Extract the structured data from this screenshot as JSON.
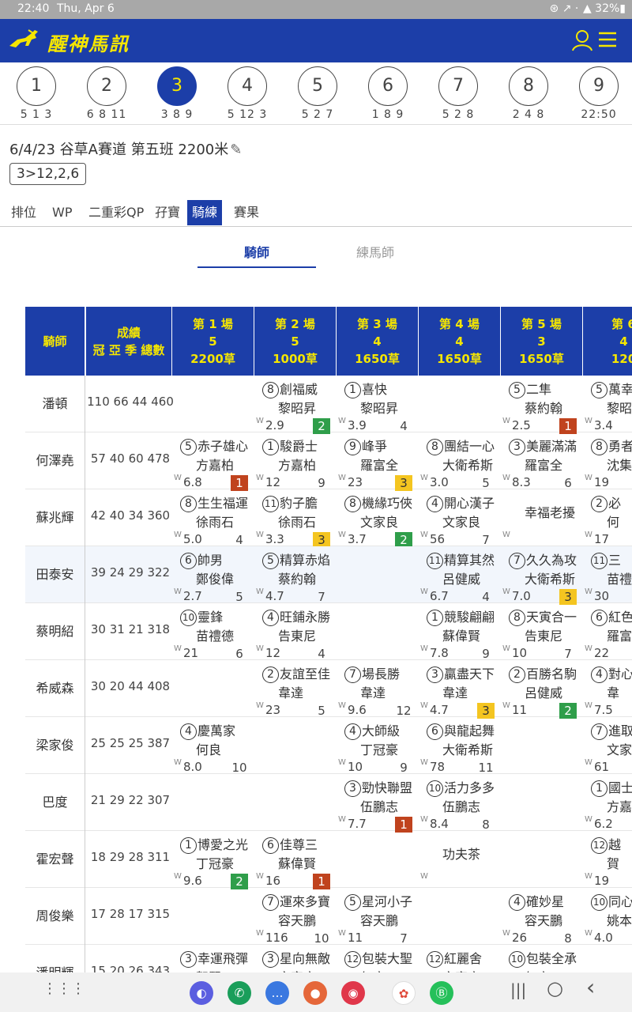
{
  "status": {
    "time": "22:40",
    "date": "Thu, Apr 6",
    "right": "⊛ ↗ ·  ▲ 32%▮"
  },
  "app": {
    "title": "醒神馬訊",
    "logo": "horse-logo",
    "accent": "#1c3ea8",
    "brand_yellow": "#f5e600"
  },
  "races": [
    {
      "num": "1",
      "sub": "5 1 3"
    },
    {
      "num": "2",
      "sub": "6 8 11"
    },
    {
      "num": "3",
      "sub": "3 8 9",
      "active": true
    },
    {
      "num": "4",
      "sub": "5 12 3"
    },
    {
      "num": "5",
      "sub": "5 2 7"
    },
    {
      "num": "6",
      "sub": "1 8 9"
    },
    {
      "num": "7",
      "sub": "5 2 8"
    },
    {
      "num": "8",
      "sub": "2 4 8"
    },
    {
      "num": "9",
      "sub": "22:50"
    }
  ],
  "race_info": "6/4/23 谷草A賽道  第五班 2200米",
  "pencil": "✎",
  "tag": "3>12,2,6",
  "tabs": [
    "排位",
    "WP",
    "二重彩QP",
    "孖寶",
    "騎練",
    "賽果"
  ],
  "active_tab": 4,
  "subtabs": [
    "騎師",
    "練馬師"
  ],
  "header": {
    "jockey": "騎師",
    "record": [
      "成績",
      "冠 亞 季 總數"
    ],
    "races": [
      [
        "第 1 場",
        "5",
        "2200草"
      ],
      [
        "第 2 場",
        "5",
        "1000草"
      ],
      [
        "第 3 場",
        "4",
        "1650草"
      ],
      [
        "第 4 場",
        "4",
        "1650草"
      ],
      [
        "第 5 場",
        "3",
        "1650草"
      ],
      [
        "第 6",
        "4",
        "120"
      ]
    ]
  },
  "w_label": "W",
  "rows": [
    {
      "jockey": "潘頓",
      "stat": "110 66 44 460",
      "cells": [
        null,
        {
          "n": "8",
          "h": "創福威",
          "j": "黎昭昇",
          "o": "2.9",
          "p": "2"
        },
        {
          "n": "1",
          "h": "喜快",
          "j": "黎昭昇",
          "o": "3.9",
          "p": "4"
        },
        null,
        {
          "n": "5",
          "h": "二隼",
          "j": "蔡約翰",
          "o": "2.5",
          "p": "1"
        },
        {
          "n": "5",
          "h": "萬幸",
          "j": "黎昭",
          "o": "3.4",
          "p": ""
        }
      ]
    },
    {
      "jockey": "何澤堯",
      "stat": "57 40 60 478",
      "cells": [
        {
          "n": "5",
          "h": "赤子雄心",
          "j": "方嘉柏",
          "o": "6.8",
          "p": "1"
        },
        {
          "n": "1",
          "h": "駿爵士",
          "j": "方嘉柏",
          "o": "12",
          "p": "9"
        },
        {
          "n": "9",
          "h": "峰爭",
          "j": "羅富全",
          "o": "23",
          "p": "3"
        },
        {
          "n": "8",
          "h": "團結一心",
          "j": "大衛希斯",
          "o": "3.0",
          "p": "5"
        },
        {
          "n": "3",
          "h": "美麗滿滿",
          "j": "羅富全",
          "o": "8.3",
          "p": "6"
        },
        {
          "n": "8",
          "h": "勇者",
          "j": "沈集",
          "o": "19",
          "p": ""
        }
      ]
    },
    {
      "jockey": "蘇兆輝",
      "stat": "42 40 34 360",
      "cells": [
        {
          "n": "8",
          "h": "生生福運",
          "j": "徐雨石",
          "o": "5.0",
          "p": "4"
        },
        {
          "n": "11",
          "h": "豹子膽",
          "j": "徐雨石",
          "o": "3.3",
          "p": "3"
        },
        {
          "n": "8",
          "h": "機緣巧俠",
          "j": "文家良",
          "o": "3.7",
          "p": "2"
        },
        {
          "n": "4",
          "h": "開心漢子",
          "j": "文家良",
          "o": "56",
          "p": "7"
        },
        {
          "n": "",
          "h": "幸福老擾",
          "j": "",
          "o": "",
          "p": ""
        },
        {
          "n": "2",
          "h": "必",
          "j": "何",
          "o": "17",
          "p": ""
        }
      ]
    },
    {
      "jockey": "田泰安",
      "stat": "39 24 29 322",
      "cells": [
        {
          "n": "6",
          "h": "帥男",
          "j": "鄭俊偉",
          "o": "2.7",
          "p": "5"
        },
        {
          "n": "5",
          "h": "精算赤焰",
          "j": "蔡約翰",
          "o": "4.7",
          "p": "7"
        },
        null,
        {
          "n": "11",
          "h": "精算其然",
          "j": "呂健威",
          "o": "6.7",
          "p": "4"
        },
        {
          "n": "7",
          "h": "久久為攻",
          "j": "大衛希斯",
          "o": "7.0",
          "p": "3"
        },
        {
          "n": "11",
          "h": "三",
          "j": "苗禮",
          "o": "30",
          "p": ""
        }
      ]
    },
    {
      "jockey": "蔡明紹",
      "stat": "30 31 21 318",
      "cells": [
        {
          "n": "10",
          "h": "靈鋒",
          "j": "苗禮德",
          "o": "21",
          "p": "6"
        },
        {
          "n": "4",
          "h": "旺鋪永勝",
          "j": "告東尼",
          "o": "12",
          "p": "4"
        },
        null,
        {
          "n": "1",
          "h": "競駿翩翩",
          "j": "蘇偉賢",
          "o": "7.8",
          "p": "9"
        },
        {
          "n": "8",
          "h": "天寅合一",
          "j": "告東尼",
          "o": "10",
          "p": "7"
        },
        {
          "n": "6",
          "h": "紅色",
          "j": "羅富",
          "o": "22",
          "p": ""
        }
      ]
    },
    {
      "jockey": "希威森",
      "stat": "30 20 44 408",
      "cells": [
        null,
        {
          "n": "2",
          "h": "友誼至佳",
          "j": "韋達",
          "o": "23",
          "p": "5"
        },
        {
          "n": "7",
          "h": "場長勝",
          "j": "韋達",
          "o": "9.6",
          "p": "12"
        },
        {
          "n": "3",
          "h": "贏盡天下",
          "j": "韋達",
          "o": "4.7",
          "p": "3"
        },
        {
          "n": "2",
          "h": "百勝名駒",
          "j": "呂健威",
          "o": "11",
          "p": "2"
        },
        {
          "n": "4",
          "h": "對心",
          "j": "韋",
          "o": "7.5",
          "p": ""
        }
      ]
    },
    {
      "jockey": "梁家俊",
      "stat": "25 25 25 387",
      "cells": [
        {
          "n": "4",
          "h": "慶萬家",
          "j": "何良",
          "o": "8.0",
          "p": "10"
        },
        null,
        {
          "n": "4",
          "h": "大師級",
          "j": "丁冠豪",
          "o": "10",
          "p": "9"
        },
        {
          "n": "6",
          "h": "與龍起舞",
          "j": "大衛希斯",
          "o": "78",
          "p": "11"
        },
        null,
        {
          "n": "7",
          "h": "進取",
          "j": "文家",
          "o": "61",
          "p": ""
        }
      ]
    },
    {
      "jockey": "巴度",
      "stat": "21 29 22 307",
      "cells": [
        null,
        null,
        {
          "n": "3",
          "h": "勁快聯盟",
          "j": "伍鵬志",
          "o": "7.7",
          "p": "1"
        },
        {
          "n": "10",
          "h": "活力多多",
          "j": "伍鵬志",
          "o": "8.4",
          "p": "8"
        },
        null,
        {
          "n": "1",
          "h": "國士",
          "j": "方嘉",
          "o": "6.2",
          "p": ""
        }
      ]
    },
    {
      "jockey": "霍宏聲",
      "stat": "18 29 28 311",
      "cells": [
        {
          "n": "1",
          "h": "博愛之光",
          "j": "丁冠豪",
          "o": "9.6",
          "p": "2"
        },
        {
          "n": "6",
          "h": "佳尊三",
          "j": "蘇偉賢",
          "o": "16",
          "p": "1"
        },
        null,
        {
          "n": "",
          "h": "功夫茶",
          "j": "",
          "o": "",
          "p": ""
        },
        null,
        {
          "n": "12",
          "h": "越",
          "j": "賀",
          "o": "19",
          "p": ""
        }
      ]
    },
    {
      "jockey": "周俊樂",
      "stat": "17 28 17 315",
      "cells": [
        null,
        {
          "n": "7",
          "h": "運來多寶",
          "j": "容天鵬",
          "o": "116",
          "p": "10"
        },
        {
          "n": "5",
          "h": "星河小子",
          "j": "容天鵬",
          "o": "11",
          "p": "7"
        },
        null,
        {
          "n": "4",
          "h": "確妙星",
          "j": "容天鵬",
          "o": "26",
          "p": "8"
        },
        {
          "n": "10",
          "h": "同心",
          "j": "姚本",
          "o": "4.0",
          "p": ""
        }
      ]
    },
    {
      "jockey": "潘明輝",
      "stat": "15 20 26 343",
      "cells": [
        {
          "n": "3",
          "h": "幸運飛彈",
          "j": "賀賢",
          "o": "",
          "p": ""
        },
        {
          "n": "3",
          "h": "星向無敵",
          "j": "文家良",
          "o": "",
          "p": ""
        },
        {
          "n": "12",
          "h": "包裝大聖",
          "j": "何良",
          "o": "",
          "p": ""
        },
        {
          "n": "12",
          "h": "紅麗舍",
          "j": "文家良",
          "o": "",
          "p": ""
        },
        {
          "n": "10",
          "h": "包裝全承",
          "j": "何良",
          "o": "",
          "p": ""
        },
        null
      ]
    }
  ],
  "nav": {
    "recents": "|||",
    "home": "○",
    "back": "‹"
  }
}
